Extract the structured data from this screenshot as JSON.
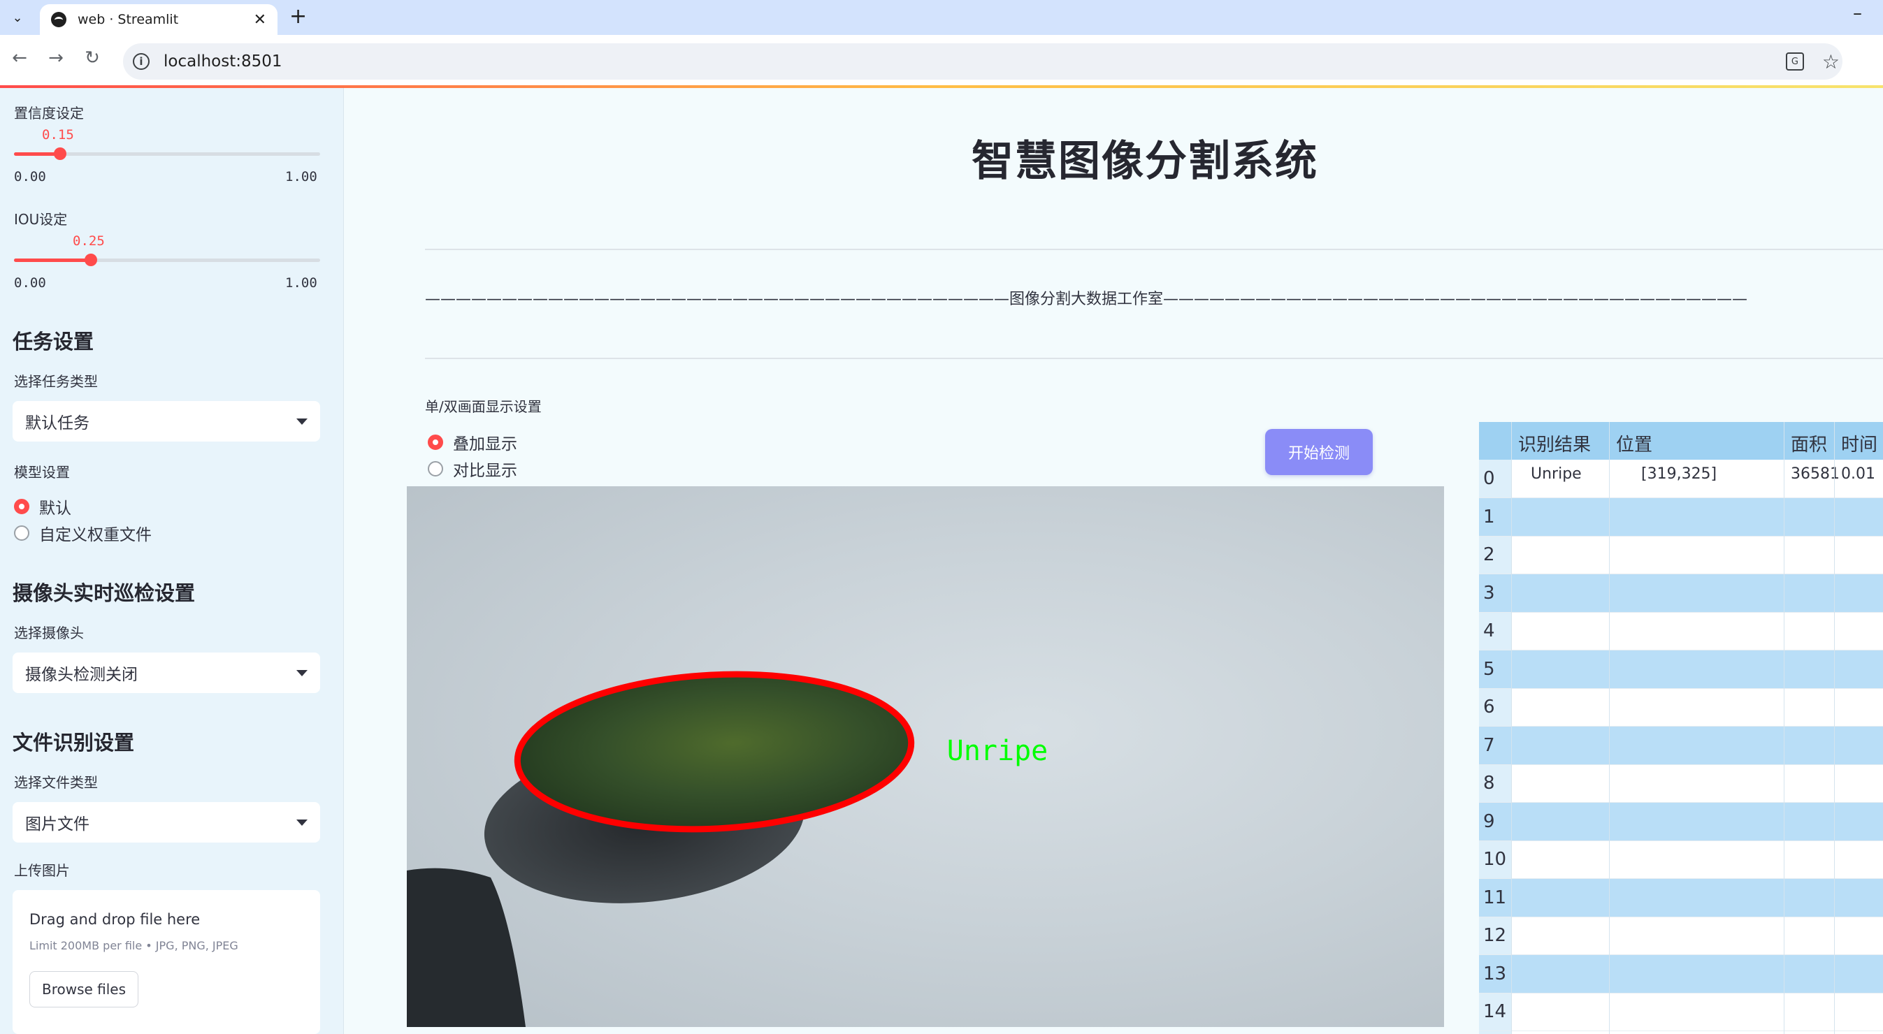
{
  "browser": {
    "tab_title": "web · Streamlit",
    "tab_close": "✕",
    "new_tab": "+",
    "minimize": "–",
    "url": "localhost:8501",
    "back": "←",
    "forward": "→",
    "reload": "↻",
    "menu": "⌄",
    "translate": "G",
    "bookmark": "☆",
    "info": "i"
  },
  "sidebar": {
    "confidence": {
      "label": "置信度设定",
      "value": "0.15",
      "value_fraction": 0.15,
      "min": "0.00",
      "max": "1.00"
    },
    "iou": {
      "label": "IOU设定",
      "value": "0.25",
      "value_fraction": 0.25,
      "min": "0.00",
      "max": "1.00"
    },
    "task_heading": "任务设置",
    "task_type_label": "选择任务类型",
    "task_type_value": "默认任务",
    "model_label": "模型设置",
    "model_options": [
      "默认",
      "自定义权重文件"
    ],
    "model_selected": 0,
    "camera_heading": "摄像头实时巡检设置",
    "camera_label": "选择摄像头",
    "camera_value": "摄像头检测关闭",
    "file_heading": "文件识别设置",
    "file_type_label": "选择文件类型",
    "file_type_value": "图片文件",
    "upload_label": "上传图片",
    "upload_title": "Drag and drop file here",
    "upload_sub": "Limit 200MB per file • JPG, PNG, JPEG",
    "upload_button": "Browse files"
  },
  "main": {
    "title": "智慧图像分割系统",
    "divider_text": "——————————————————————————————————————图像分割大数据工作室——————————————————————————————————————",
    "display_label": "单/双画面显示设置",
    "display_options": [
      "叠加显示",
      "对比显示"
    ],
    "display_selected": 0,
    "start_button": "开始检测",
    "detection_label": "Unripe"
  },
  "table": {
    "headers": [
      "识别结果",
      "位置",
      "面积",
      "时间"
    ],
    "rows": [
      {
        "index": "0",
        "result": "Unripe",
        "position": "[319,325]",
        "area": "36581",
        "time": "0.01"
      },
      {
        "index": "1",
        "result": "",
        "position": "",
        "area": "",
        "time": ""
      },
      {
        "index": "2",
        "result": "",
        "position": "",
        "area": "",
        "time": ""
      },
      {
        "index": "3",
        "result": "",
        "position": "",
        "area": "",
        "time": ""
      },
      {
        "index": "4",
        "result": "",
        "position": "",
        "area": "",
        "time": ""
      },
      {
        "index": "5",
        "result": "",
        "position": "",
        "area": "",
        "time": ""
      },
      {
        "index": "6",
        "result": "",
        "position": "",
        "area": "",
        "time": ""
      },
      {
        "index": "7",
        "result": "",
        "position": "",
        "area": "",
        "time": ""
      },
      {
        "index": "8",
        "result": "",
        "position": "",
        "area": "",
        "time": ""
      },
      {
        "index": "9",
        "result": "",
        "position": "",
        "area": "",
        "time": ""
      },
      {
        "index": "10",
        "result": "",
        "position": "",
        "area": "",
        "time": ""
      },
      {
        "index": "11",
        "result": "",
        "position": "",
        "area": "",
        "time": ""
      },
      {
        "index": "12",
        "result": "",
        "position": "",
        "area": "",
        "time": ""
      },
      {
        "index": "13",
        "result": "",
        "position": "",
        "area": "",
        "time": ""
      },
      {
        "index": "14",
        "result": "",
        "position": "",
        "area": "",
        "time": ""
      }
    ]
  },
  "colors": {
    "accent": "#ff4b4b",
    "button": "#8a8cf7",
    "table_header": "#9ed1f2",
    "mask_outline": "#ff0000",
    "label_green": "#00ff00"
  }
}
